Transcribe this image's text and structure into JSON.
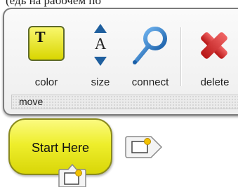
{
  "top_cut_text": "(едь на рабочем по",
  "toolbar": {
    "color_label": "color",
    "size_label": "size",
    "connect_label": "connect",
    "delete_label": "delete",
    "move_label": "move"
  },
  "node": {
    "label": "Start Here",
    "fill_color": "#eeee2c",
    "border_color": "#8a8a1e"
  },
  "icons": {
    "color": "text-color-icon",
    "color_glyph": "T",
    "size": "font-size-icon",
    "size_glyph": "A",
    "connect": "connect-icon",
    "delete": "delete-x-icon",
    "add_right": "add-node-right-icon",
    "add_below": "add-node-below-icon"
  },
  "colors": {
    "accent_blue": "#2a7fd0",
    "delete_red": "#d42a2a",
    "node_yellow": "#eeee2c"
  }
}
